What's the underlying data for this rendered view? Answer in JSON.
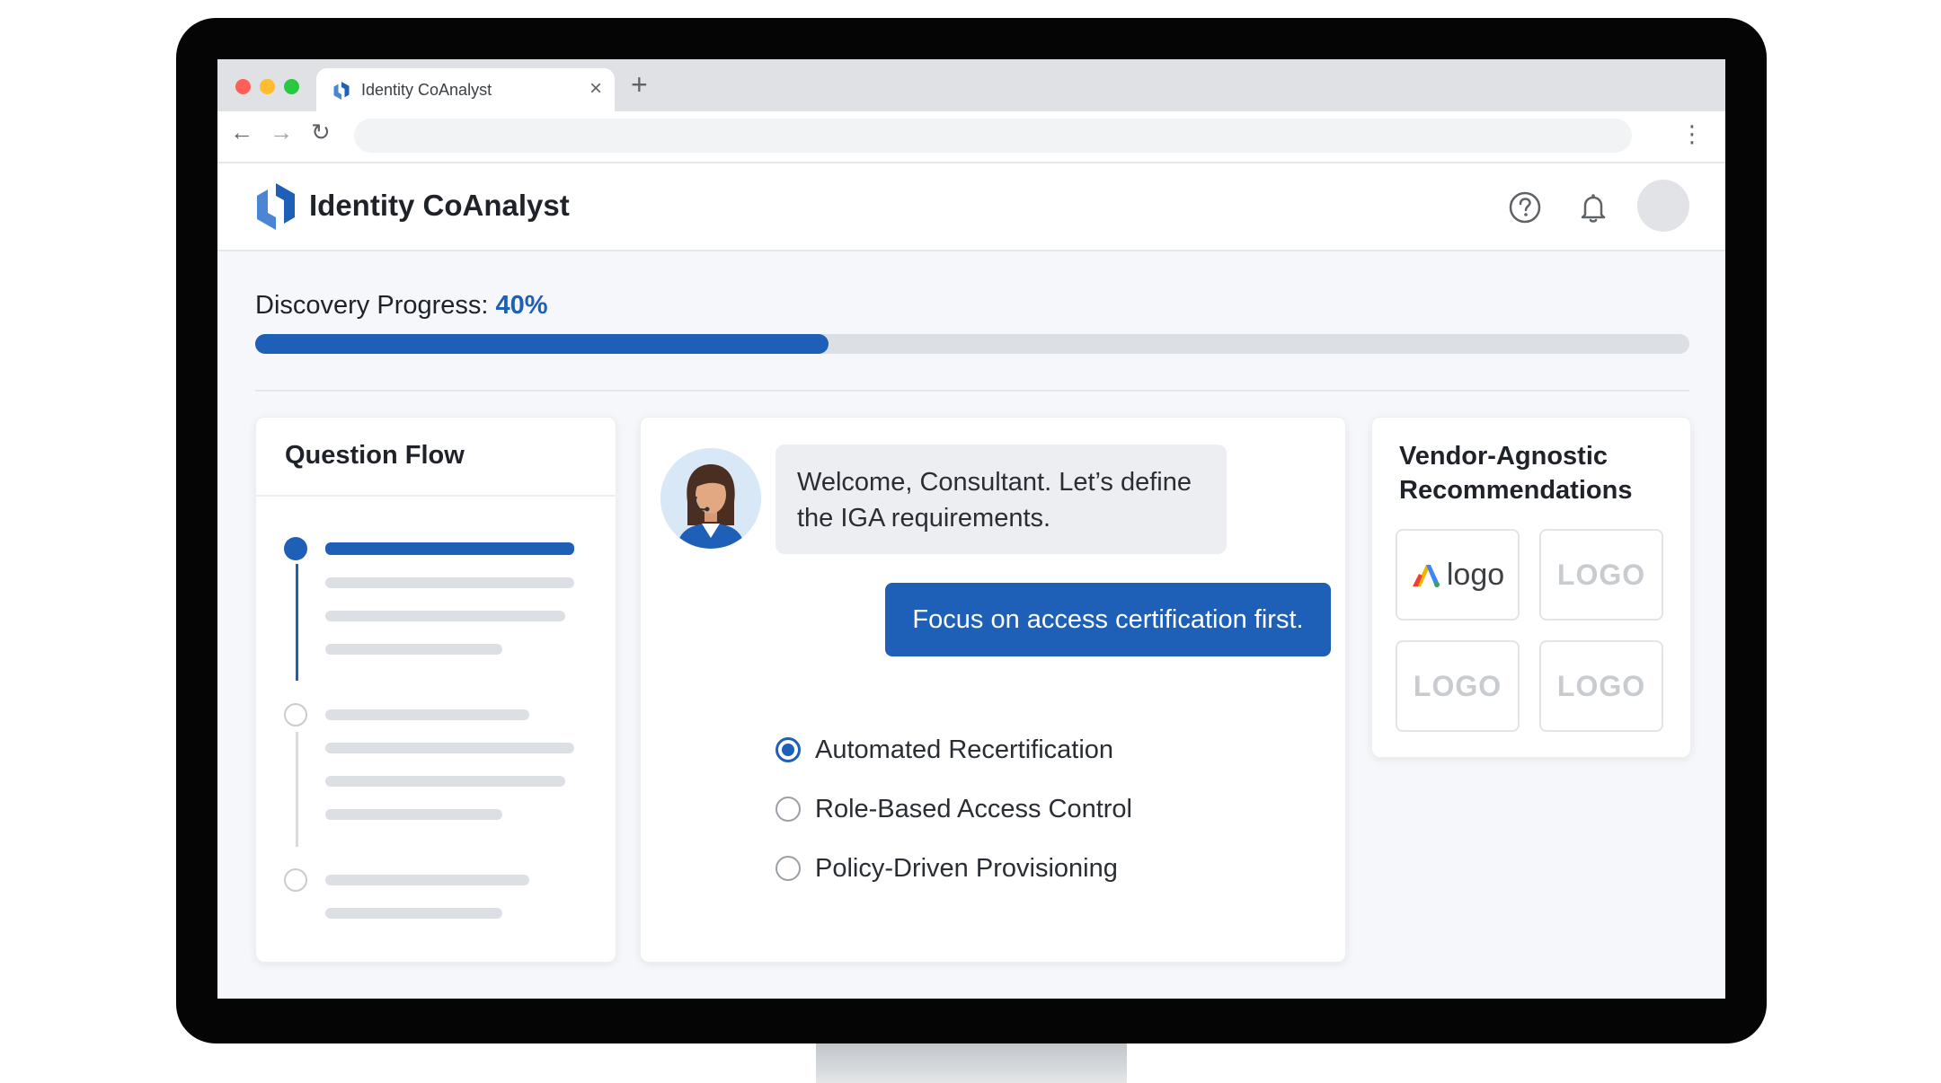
{
  "browser": {
    "tab_title": "Identity CoAnalyst",
    "tab_close": "×",
    "new_tab": "+"
  },
  "app": {
    "title": "Identity CoAnalyst"
  },
  "progress": {
    "label": "Discovery Progress: ",
    "percent_text": "40%",
    "fraction": 0.4
  },
  "question_flow": {
    "title": "Question Flow"
  },
  "chat": {
    "agent_message": "Welcome, Consultant. Let’s define the IGA requirements.",
    "user_message": "Focus on access certification first.",
    "options": [
      {
        "label": "Automated Recertification",
        "selected": true
      },
      {
        "label": "Role-Based Access Control",
        "selected": false
      },
      {
        "label": "Policy-Driven Provisioning",
        "selected": false
      }
    ]
  },
  "vendor": {
    "title": "Vendor-Agnostic Recommendations",
    "tiles": [
      "logo",
      "LOGO",
      "LOGO",
      "LOGO"
    ]
  },
  "colors": {
    "accent": "#1e5fb8",
    "page_bg": "#f5f7fa"
  }
}
